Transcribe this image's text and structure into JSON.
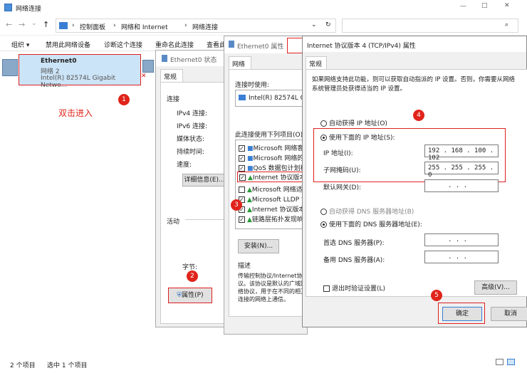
{
  "window": {
    "title": "网络连接",
    "min": "—",
    "max": "□",
    "close": "✕"
  },
  "address": {
    "back": "←",
    "forward": "→",
    "up": "↑",
    "down": "⌄",
    "crumbs": [
      "控制面板",
      "网络和 Internet",
      "网络连接"
    ],
    "sep": "›",
    "dropdown": "⌄",
    "refresh": "↻",
    "search": "⌕"
  },
  "toolbar": {
    "items": [
      "组织 ▾",
      "禁用此网络设备",
      "诊断这个连接",
      "重命名此连接",
      "查看此"
    ]
  },
  "adapter": {
    "name": "Ethernet0",
    "network": "网络 2",
    "device": "Intel(R) 82574L Gigabit Netwo..."
  },
  "annot": {
    "double_click": "双击进入",
    "b1": "1",
    "b2": "2",
    "b3": "3",
    "b4": "4",
    "b5": "5"
  },
  "status": {
    "items": "2 个项目",
    "selected": "选中 1 个项目"
  },
  "status_dialog": {
    "title": "Ethernet0 状态",
    "tab": "常规",
    "section_conn": "连接",
    "rows": [
      "IPv4 连接:",
      "IPv6 连接:",
      "媒体状态:",
      "持续时间:",
      "速度:"
    ],
    "details": "详细信息(E)...",
    "activity": "活动",
    "bytes": "字节:",
    "properties": "属性(P)"
  },
  "props_dialog": {
    "title": "Ethernet0 属性",
    "tab": "网络",
    "connect_using": "连接时使用:",
    "adapter": "Intel(R) 82574L Gigabit",
    "items_label": "此连接使用下列项目(O):",
    "items": [
      "Microsoft 网络客户端",
      "Microsoft 网络的文件",
      "QoS 数据包计划程序",
      "Internet 协议版本 4",
      "Microsoft 网络适配",
      "Microsoft LLDP 协议",
      "Internet 协议版本 6",
      "链路层拓扑发现响应"
    ],
    "install": "安装(N)...",
    "desc_label": "描述",
    "desc": "传输控制协议/Internet协议。该协议是默认的广域网络协议，用于在不同的相互连接的网络上通信。"
  },
  "ipv4": {
    "title": "Internet 协议版本 4 (TCP/IPv4) 属性",
    "tab": "常规",
    "intro": "如果网络支持此功能，则可以获取自动指派的 IP 设置。否则，你需要从网络系统管理员处获得适当的 IP 设置。",
    "auto_ip": "自动获得 IP 地址(O)",
    "use_ip": "使用下面的 IP 地址(S):",
    "ip_label": "IP 地址(I):",
    "ip": "192 . 168 . 100 . 102",
    "mask_label": "子网掩码(U):",
    "mask": "255 . 255 . 255 . 0",
    "gw_label": "默认网关(D):",
    "gw": ". . .",
    "auto_dns": "自动获得 DNS 服务器地址(B)",
    "use_dns": "使用下面的 DNS 服务器地址(E):",
    "dns1_label": "首选 DNS 服务器(P):",
    "dns1": ". . .",
    "dns2_label": "备用 DNS 服务器(A):",
    "dns2": ". . .",
    "validate": "退出时验证设置(L)",
    "advanced": "高级(V)...",
    "ok": "确定",
    "cancel": "取消"
  }
}
